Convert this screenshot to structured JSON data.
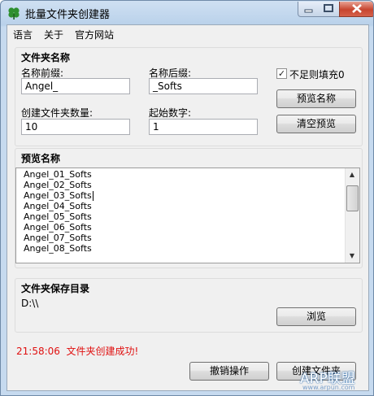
{
  "window": {
    "title": "批量文件夹创建器"
  },
  "menu": [
    {
      "label": "语言"
    },
    {
      "label": "关于"
    },
    {
      "label": "官方网站"
    }
  ],
  "folder_name_group": {
    "title": "文件夹名称",
    "prefix_label": "名称前缀:",
    "prefix_value": "Angel_",
    "suffix_label": "名称后缀:",
    "suffix_value": "_Softs",
    "count_label": "创建文件夹数量:",
    "count_value": "10",
    "start_label": "起始数字:",
    "start_value": "1",
    "pad_checkbox_label": "不足则填充0",
    "pad_checked": true,
    "preview_button": "预览名称",
    "clear_button": "清空预览"
  },
  "preview_group": {
    "title": "预览名称",
    "items": [
      "Angel_01_Softs",
      "Angel_02_Softs",
      "Angel_03_Softs",
      "Angel_04_Softs",
      "Angel_05_Softs",
      "Angel_06_Softs",
      "Angel_07_Softs",
      "Angel_08_Softs"
    ]
  },
  "save_group": {
    "title": "文件夹保存目录",
    "path": "D:\\\\",
    "browse_button": "浏览"
  },
  "status": {
    "time": "21:58:06",
    "message": "文件夹创建成功!",
    "color": "#e01010"
  },
  "actions": {
    "undo_button": "撤销操作",
    "create_button": "创建文件夹"
  },
  "watermark": {
    "text": "ARP联盟",
    "url": "www.arpun.com"
  },
  "icons": {
    "app": "clover-icon",
    "checkbox": "check-icon",
    "scroll_up": "chevron-up-icon",
    "scroll_down": "chevron-down-icon"
  }
}
